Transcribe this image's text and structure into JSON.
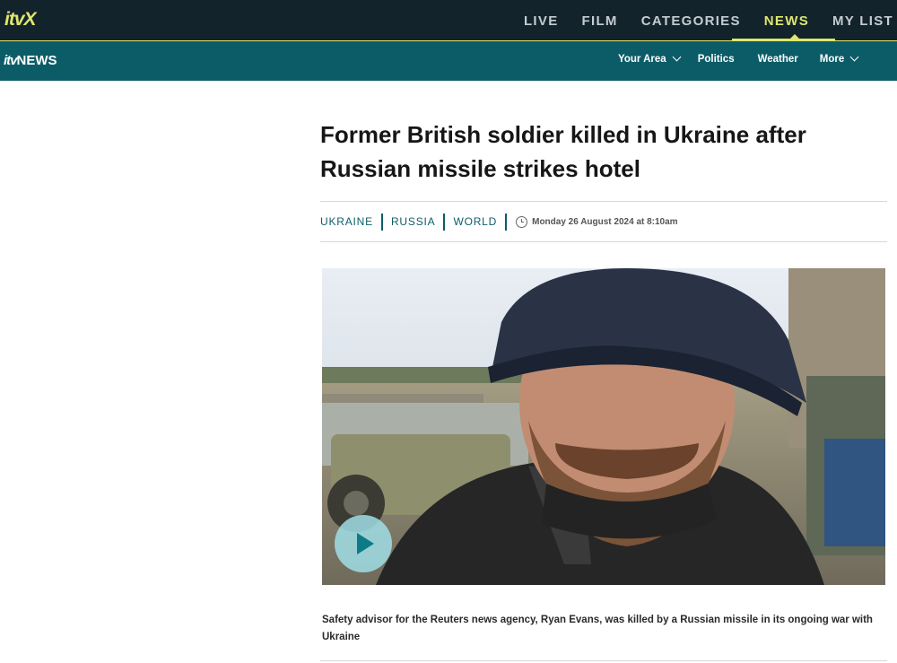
{
  "brand": {
    "logo": "itvX",
    "news_logo_itv": "itv",
    "news_logo_news": "NEWS"
  },
  "topnav": {
    "items": [
      {
        "label": "LIVE"
      },
      {
        "label": "FILM"
      },
      {
        "label": "CATEGORIES"
      },
      {
        "label": "NEWS",
        "active": true
      },
      {
        "label": "MY LIST"
      }
    ]
  },
  "subnav": {
    "items": [
      {
        "label": "Your Area",
        "has_dropdown": true
      },
      {
        "label": "Politics"
      },
      {
        "label": "Weather"
      },
      {
        "label": "More",
        "has_dropdown": true
      }
    ]
  },
  "article": {
    "headline": "Former British soldier killed in Ukraine after Russian missile strikes hotel",
    "tags": [
      "UKRAINE",
      "RUSSIA",
      "WORLD"
    ],
    "timestamp": "Monday 26 August 2024 at 8:10am",
    "caption": "Safety advisor for the Reuters news agency, Ryan Evans, was killed by a Russian missile in its ongoing war with Ukraine"
  },
  "colors": {
    "topbar_bg": "#13232c",
    "accent_yellow": "#dee66f",
    "news_teal": "#0c5c68",
    "play_button": "#a0dee6"
  },
  "icons": {
    "clock": "clock-icon",
    "play": "play-icon",
    "dropdown": "chevron-down-icon"
  }
}
